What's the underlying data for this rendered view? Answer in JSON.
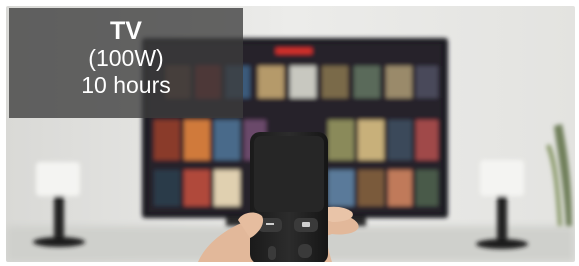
{
  "caption": {
    "title": "TV",
    "power": "(100W)",
    "duration": "10 hours"
  },
  "image": {
    "subject": "hand-holding-remote-in-front-of-tv-icon"
  }
}
